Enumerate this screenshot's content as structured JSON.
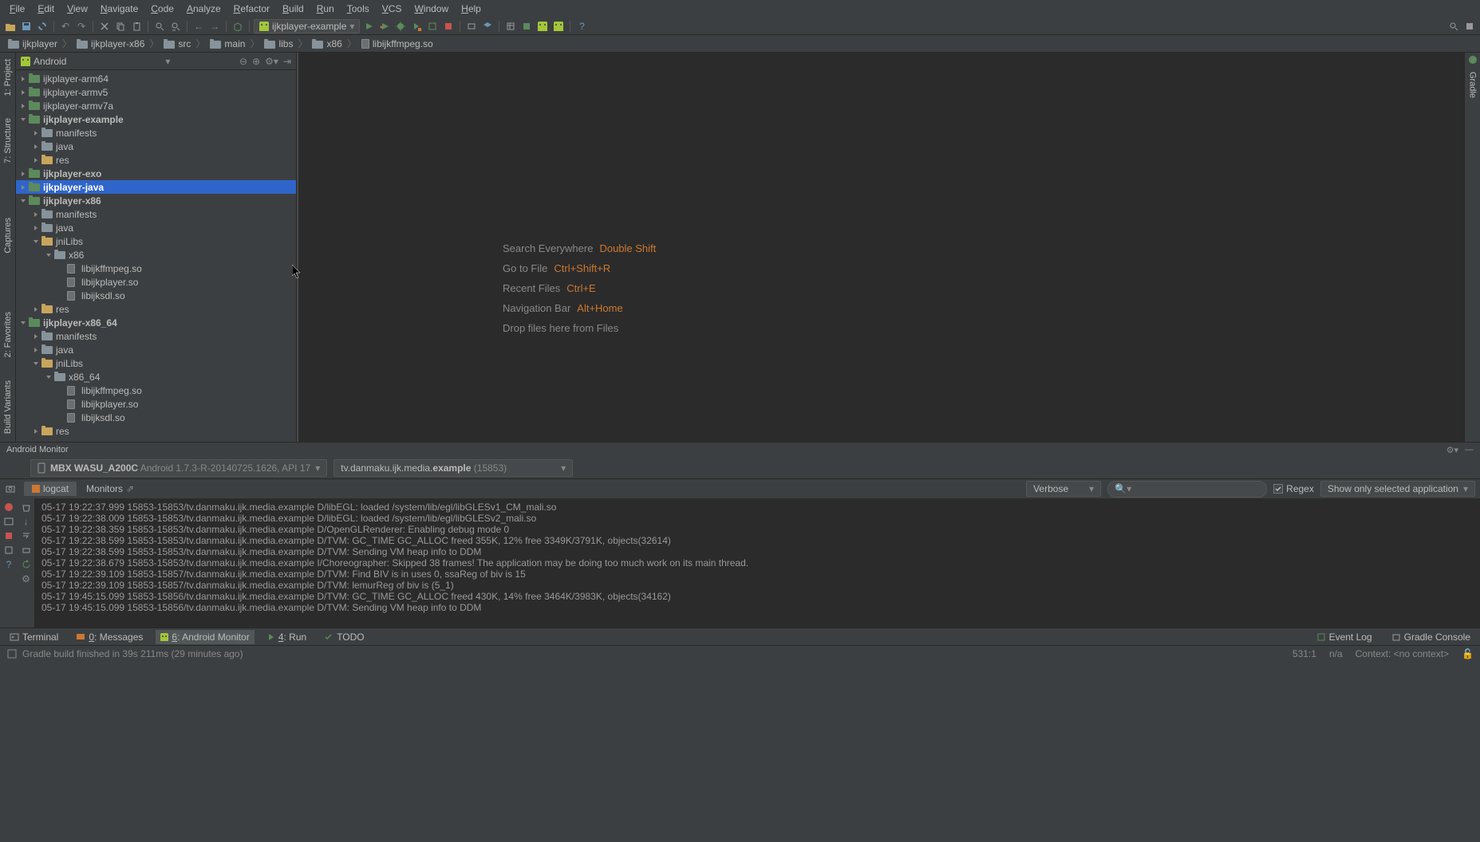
{
  "menu": [
    "File",
    "Edit",
    "View",
    "Navigate",
    "Code",
    "Analyze",
    "Refactor",
    "Build",
    "Run",
    "Tools",
    "VCS",
    "Window",
    "Help"
  ],
  "run_config": "ijkplayer-example",
  "breadcrumb": [
    "ijkplayer",
    "ijkplayer-x86",
    "src",
    "main",
    "libs",
    "x86",
    "libijkffmpeg.so"
  ],
  "panel_title": "Android",
  "tree": [
    {
      "d": 0,
      "t": "ijkplayer-arm64",
      "ic": "module",
      "ar": "r"
    },
    {
      "d": 0,
      "t": "ijkplayer-armv5",
      "ic": "module",
      "ar": "r"
    },
    {
      "d": 0,
      "t": "ijkplayer-armv7a",
      "ic": "module",
      "ar": "r"
    },
    {
      "d": 0,
      "t": "ijkplayer-example",
      "ic": "module",
      "ar": "d",
      "bold": true
    },
    {
      "d": 1,
      "t": "manifests",
      "ic": "folder",
      "ar": "r"
    },
    {
      "d": 1,
      "t": "java",
      "ic": "folder",
      "ar": "r"
    },
    {
      "d": 1,
      "t": "res",
      "ic": "res",
      "ar": "r"
    },
    {
      "d": 0,
      "t": "ijkplayer-exo",
      "ic": "module",
      "ar": "r",
      "bold": true
    },
    {
      "d": 0,
      "t": "ijkplayer-java",
      "ic": "module",
      "ar": "r",
      "bold": true,
      "sel": true
    },
    {
      "d": 0,
      "t": "ijkplayer-x86",
      "ic": "module",
      "ar": "d",
      "bold": true
    },
    {
      "d": 1,
      "t": "manifests",
      "ic": "folder",
      "ar": "r"
    },
    {
      "d": 1,
      "t": "java",
      "ic": "folder",
      "ar": "r"
    },
    {
      "d": 1,
      "t": "jniLibs",
      "ic": "res",
      "ar": "d"
    },
    {
      "d": 2,
      "t": "x86",
      "ic": "folder",
      "ar": "d"
    },
    {
      "d": 3,
      "t": "libijkffmpeg.so",
      "ic": "file"
    },
    {
      "d": 3,
      "t": "libijkplayer.so",
      "ic": "file"
    },
    {
      "d": 3,
      "t": "libijksdl.so",
      "ic": "file"
    },
    {
      "d": 1,
      "t": "res",
      "ic": "res",
      "ar": "r"
    },
    {
      "d": 0,
      "t": "ijkplayer-x86_64",
      "ic": "module",
      "ar": "d",
      "bold": true
    },
    {
      "d": 1,
      "t": "manifests",
      "ic": "folder",
      "ar": "r"
    },
    {
      "d": 1,
      "t": "java",
      "ic": "folder",
      "ar": "r"
    },
    {
      "d": 1,
      "t": "jniLibs",
      "ic": "res",
      "ar": "d"
    },
    {
      "d": 2,
      "t": "x86_64",
      "ic": "folder",
      "ar": "d"
    },
    {
      "d": 3,
      "t": "libijkffmpeg.so",
      "ic": "file"
    },
    {
      "d": 3,
      "t": "libijkplayer.so",
      "ic": "file"
    },
    {
      "d": 3,
      "t": "libijksdl.so",
      "ic": "file"
    },
    {
      "d": 1,
      "t": "res",
      "ic": "res",
      "ar": "r"
    }
  ],
  "hints": [
    {
      "l": "Search Everywhere",
      "k": "Double Shift"
    },
    {
      "l": "Go to File",
      "k": "Ctrl+Shift+R"
    },
    {
      "l": "Recent Files",
      "k": "Ctrl+E"
    },
    {
      "l": "Navigation Bar",
      "k": "Alt+Home"
    },
    {
      "l": "Drop files here from Files",
      "k": ""
    }
  ],
  "am_title": "Android Monitor",
  "am_device": "MBX WASU_A200C",
  "am_device_detail": "Android 1.7.3-R-20140725.1626, API 17",
  "am_process_pkg": "tv.danmaku.ijk.media.",
  "am_process_bold": "example",
  "am_process_pid": " (15853)",
  "am_tab1": "logcat",
  "am_tab2": "Monitors",
  "am_level": "Verbose",
  "am_search_ph": "",
  "am_regex": "Regex",
  "am_filter": "Show only selected application",
  "log_lines": [
    "05-17 19:22:37.999 15853-15853/tv.danmaku.ijk.media.example D/libEGL: loaded /system/lib/egl/libGLESv1_CM_mali.so",
    "05-17 19:22:38.009 15853-15853/tv.danmaku.ijk.media.example D/libEGL: loaded /system/lib/egl/libGLESv2_mali.so",
    "05-17 19:22:38.359 15853-15853/tv.danmaku.ijk.media.example D/OpenGLRenderer: Enabling debug mode 0",
    "05-17 19:22:38.599 15853-15853/tv.danmaku.ijk.media.example D/TVM: GC_TIME GC_ALLOC freed 355K, 12% free 3349K/3791K, objects(32614)",
    "05-17 19:22:38.599 15853-15853/tv.danmaku.ijk.media.example D/TVM: Sending VM heap info to DDM",
    "05-17 19:22:38.679 15853-15853/tv.danmaku.ijk.media.example I/Choreographer: Skipped 38 frames!  The application may be doing too much work on its main thread.",
    "05-17 19:22:39.109 15853-15857/tv.danmaku.ijk.media.example D/TVM: Find BIV is in uses 0, ssaReg of biv is 15",
    "05-17 19:22:39.109 15853-15857/tv.danmaku.ijk.media.example D/TVM: lemurReg of biv is (5_1)",
    "05-17 19:45:15.099 15853-15856/tv.danmaku.ijk.media.example D/TVM: GC_TIME GC_ALLOC freed 430K, 14% free 3464K/3983K, objects(34162)",
    "05-17 19:45:15.099 15853-15856/tv.danmaku.ijk.media.example D/TVM: Sending VM heap info to DDM"
  ],
  "bottom_items": [
    {
      "l": "Terminal",
      "ic": "term"
    },
    {
      "l": "0: Messages",
      "ic": "msg"
    },
    {
      "l": "6: Android Monitor",
      "ic": "android",
      "active": true
    },
    {
      "l": "4: Run",
      "ic": "run"
    },
    {
      "l": "TODO",
      "ic": "todo"
    }
  ],
  "bottom_right": [
    "Event Log",
    "Gradle Console"
  ],
  "status_msg": "Gradle build finished in 39s 211ms (29 minutes ago)",
  "status_pos": "531:1",
  "status_enc": "n/a",
  "status_ctx": "Context: <no context>",
  "gutter_left": [
    "1: Project",
    "7: Structure"
  ],
  "gutter_left2": "Captures",
  "gutter_left3": [
    "2: Favorites",
    "Build Variants"
  ],
  "gutter_right": "Gradle"
}
